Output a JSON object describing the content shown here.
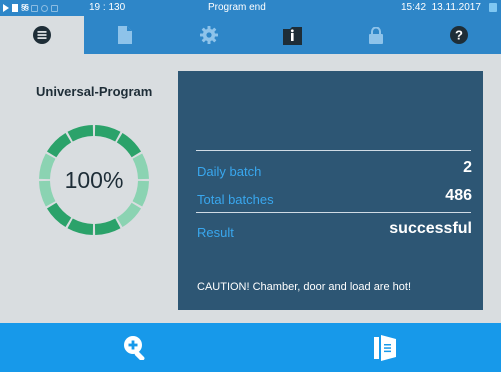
{
  "status_bar": {
    "counter": "19 : 130",
    "program_status": "Program end",
    "time": "15:42",
    "date": "13.11.2017"
  },
  "tabs": [
    {
      "icon": "list-icon",
      "active": true
    },
    {
      "icon": "document-icon",
      "active": false
    },
    {
      "icon": "gear-icon",
      "active": false
    },
    {
      "icon": "info-folder-icon",
      "active": false
    },
    {
      "icon": "lock-icon",
      "active": false
    },
    {
      "icon": "help-icon",
      "active": false
    }
  ],
  "main": {
    "program_name": "Universal-Program",
    "progress_label": "100%",
    "progress_fraction": 1.0
  },
  "info": {
    "daily_batch_label": "Daily batch",
    "daily_batch_value": "2",
    "total_batches_label": "Total batches",
    "total_batches_value": "486",
    "result_label": "Result",
    "result_value": "successful",
    "caution_text": "CAUTION! Chamber, door and load are hot!"
  },
  "bottom_bar": {
    "zoom_icon": "zoom-in-icon",
    "door_icon": "door-open-icon"
  },
  "colors": {
    "header_blue": "#2e86c8",
    "bottom_blue": "#1799ea",
    "panel_gray": "#d9dde0",
    "info_box": "#2d5674",
    "label_blue": "#39a7ee",
    "gauge_dark_green": "#2ba26a",
    "gauge_light_green": "#8bd3b2"
  }
}
